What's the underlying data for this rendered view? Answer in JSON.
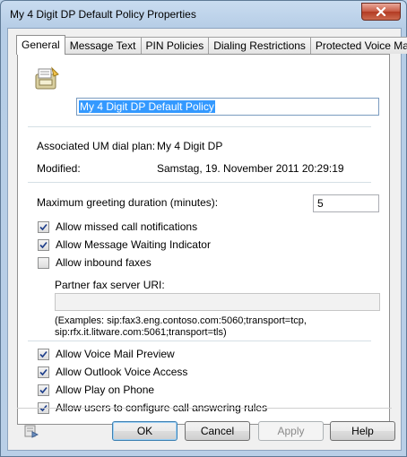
{
  "window": {
    "title": "My 4 Digit DP Default Policy Properties"
  },
  "tabs": [
    {
      "label": "General"
    },
    {
      "label": "Message Text"
    },
    {
      "label": "PIN Policies"
    },
    {
      "label": "Dialing Restrictions"
    },
    {
      "label": "Protected Voice Mail"
    }
  ],
  "general": {
    "policy_name": "My 4 Digit DP Default Policy",
    "dial_plan_label": "Associated UM dial plan:",
    "dial_plan_value": "My 4 Digit DP",
    "modified_label": "Modified:",
    "modified_value": "Samstag, 19. November 2011 20:29:19",
    "max_greeting_label": "Maximum greeting duration (minutes):",
    "max_greeting_value": "5",
    "checkboxes_top": [
      {
        "label": "Allow missed call notifications",
        "checked": true
      },
      {
        "label": "Allow Message Waiting Indicator",
        "checked": true
      },
      {
        "label": "Allow inbound faxes",
        "checked": false
      }
    ],
    "fax_uri_label": "Partner fax server URI:",
    "fax_uri_value": "",
    "fax_example_line1": "(Examples: sip:fax3.eng.contoso.com:5060;transport=tcp,",
    "fax_example_line2": "sip:rfx.it.litware.com:5061;transport=tls)",
    "checkboxes_bottom": [
      {
        "label": "Allow Voice Mail Preview",
        "checked": true
      },
      {
        "label": "Allow Outlook Voice Access",
        "checked": true
      },
      {
        "label": "Allow Play on Phone",
        "checked": true
      },
      {
        "label": "Allow users to configure call answering rules",
        "checked": true
      }
    ]
  },
  "buttons": {
    "ok": "OK",
    "cancel": "Cancel",
    "apply": "Apply",
    "help": "Help"
  },
  "icons": {
    "close": "close-icon",
    "policy": "policy-icon",
    "help_small": "help-small-icon",
    "check": "checkmark-icon"
  }
}
